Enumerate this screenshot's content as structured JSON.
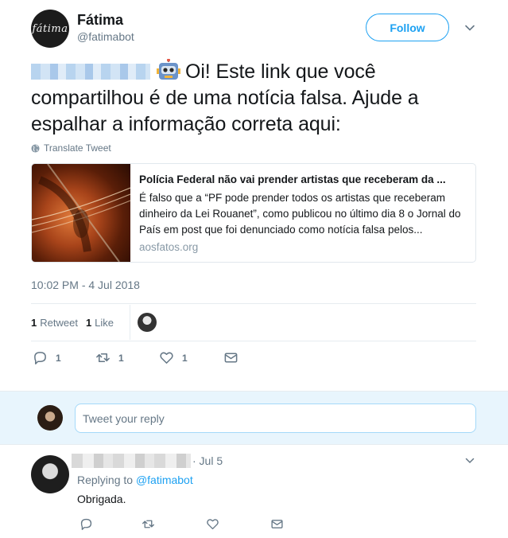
{
  "tweet": {
    "author_name": "Fátima",
    "author_handle": "@fatimabot",
    "avatar_text": "fátima",
    "follow_label": "Follow",
    "text": "Oi! Este link que você compartilhou é de uma notícia falsa. Ajude a espalhar a informação correta aqui:",
    "translate_label": "Translate Tweet",
    "card": {
      "title": "Polícia Federal não vai prender artistas que receberam da ...",
      "description": "É falso que a “PF pode prender todos os artistas que receberam dinheiro da Lei Rouanet”, como publicou no último dia 8 o Jornal do País em post que foi denunciado como notícia falsa pelos...",
      "domain": "aosfatos.org"
    },
    "timestamp": "10:02 PM - 4 Jul 2018",
    "stats": {
      "retweets_count": "1",
      "retweets_label": "Retweet",
      "likes_count": "1",
      "likes_label": "Like"
    },
    "actions": {
      "reply_count": "1",
      "retweet_count": "1",
      "like_count": "1"
    }
  },
  "reply_box": {
    "placeholder": "Tweet your reply"
  },
  "reply": {
    "time": "· Jul 5",
    "replying_to_prefix": "Replying to",
    "replying_to_handle": "@fatimabot",
    "text": "Obrigada."
  },
  "colors": {
    "accent": "#1da1f2",
    "muted": "#657786",
    "reply_bg": "#e8f5fd"
  }
}
